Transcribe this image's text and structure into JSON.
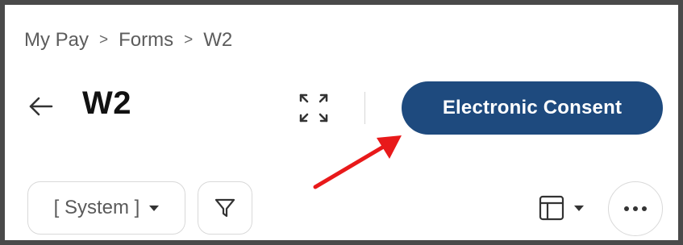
{
  "breadcrumb": {
    "items": [
      "My Pay",
      "Forms",
      "W2"
    ],
    "separator": ">"
  },
  "header": {
    "back_icon": "arrow-left-icon",
    "title": "W2",
    "expand_icon": "expand-corners-icon",
    "consent_button_label": "Electronic Consent"
  },
  "annotation": {
    "arrow_color": "#e8191a",
    "points_to": "consent-button"
  },
  "toolbar": {
    "system_select_value": "[ System ]",
    "filter_icon": "filter-funnel-icon",
    "layout_icon": "table-layout-icon",
    "more_icon": "more-horizontal-icon"
  },
  "colors": {
    "accent": "#1e4a7e",
    "border": "#4a4a4a"
  }
}
